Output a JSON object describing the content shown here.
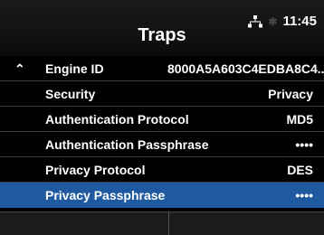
{
  "header": {
    "title": "Traps",
    "time": "11:45",
    "icons": [
      "network-icon",
      "gps-icon"
    ]
  },
  "parent_item": {
    "label": "Engine ID",
    "value": "8000A5A603C4EDBA8C4..."
  },
  "items": [
    {
      "label": "Security",
      "value": "Privacy"
    },
    {
      "label": "Authentication Protocol",
      "value": "MD5"
    },
    {
      "label": "Authentication Passphrase",
      "value": "••••"
    },
    {
      "label": "Privacy Protocol",
      "value": "DES"
    },
    {
      "label": "Privacy Passphrase",
      "value": "••••"
    }
  ],
  "colors": {
    "selected": "#1f5aa1",
    "background": "#000000"
  }
}
